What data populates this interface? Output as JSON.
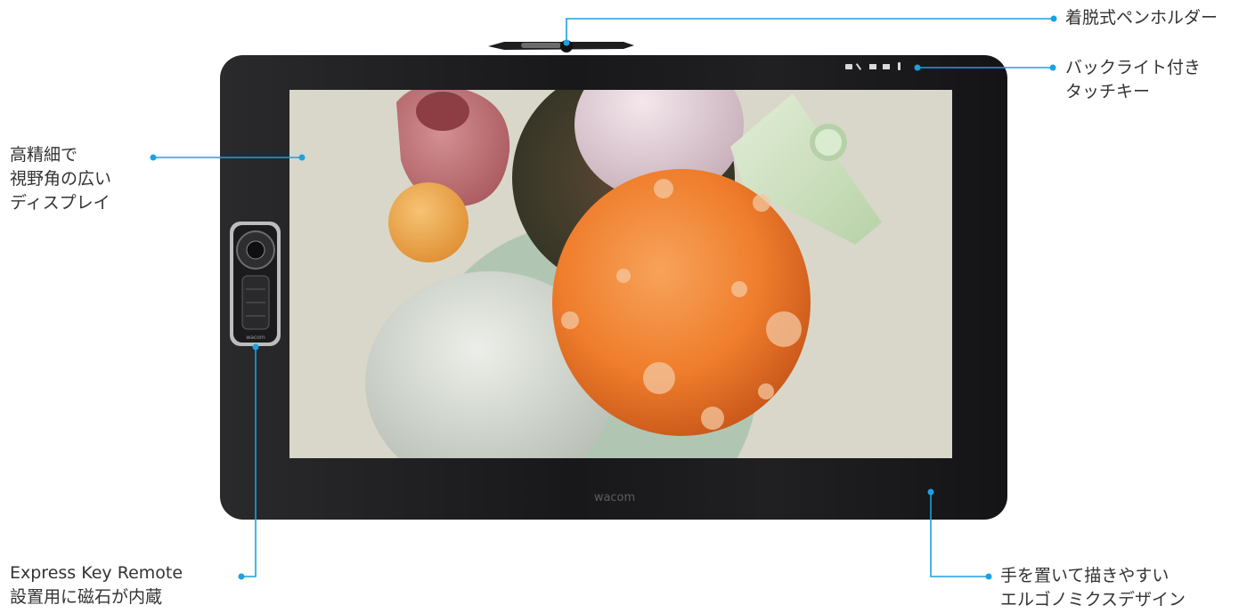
{
  "labels": {
    "pen_holder": "着脱式ペンホルダー",
    "touch_keys": [
      "バックライト付き",
      "タッチキー"
    ],
    "display": [
      "高精細で",
      "視野角の広い",
      "ディスプレイ"
    ],
    "remote": [
      "Express Key Remote",
      "設置用に磁石が内蔵"
    ],
    "ergonomic": [
      "手を置いて描きやすい",
      "エルゴノミクスデザイン"
    ]
  },
  "device": {
    "brand_logo": "wacom",
    "remote_logo": "wacom",
    "touch_key_icons": [
      "home-icon",
      "pen-icon",
      "keyboard-icon",
      "menu-icon",
      "touch-icon"
    ]
  },
  "colors": {
    "leader_line": "#1ba1e2",
    "bezel": "#1c1c1e",
    "screen_background": "#d9d7c9",
    "text": "#333333"
  }
}
